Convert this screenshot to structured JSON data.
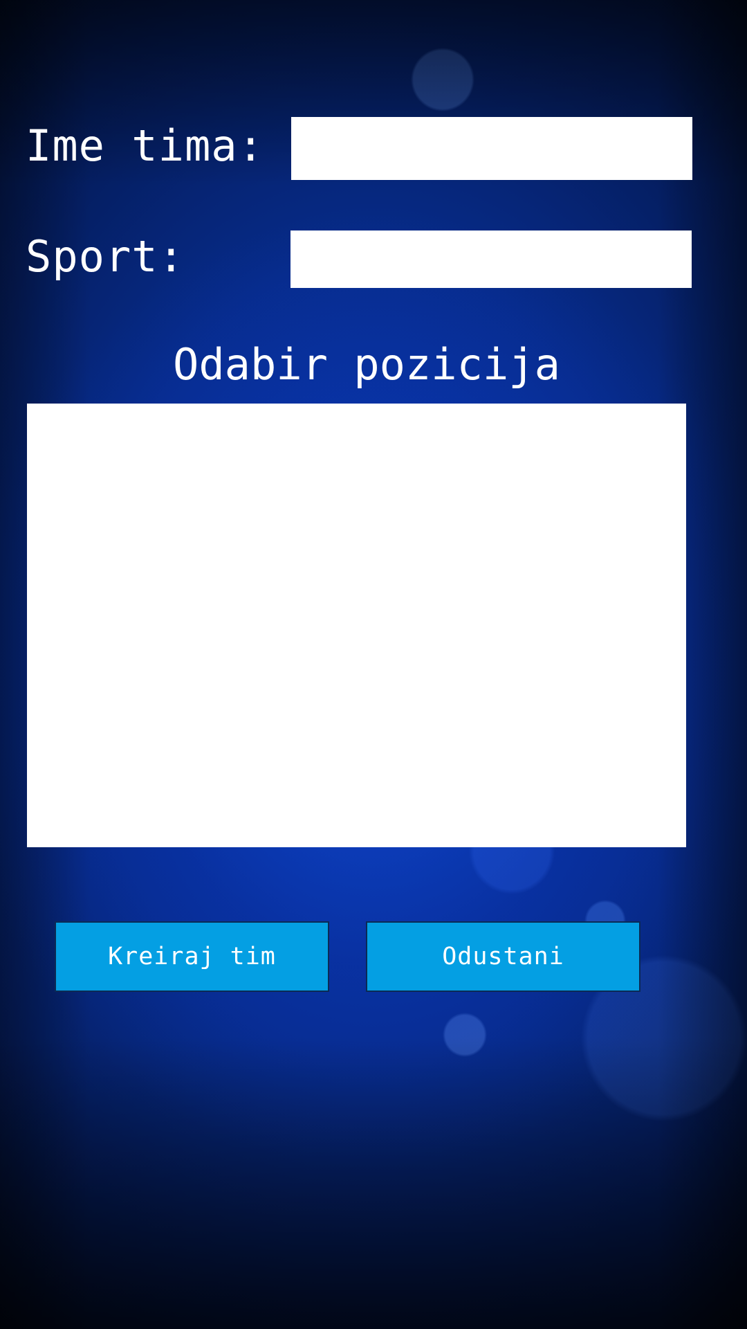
{
  "form": {
    "team_name_label": "Ime tima:",
    "team_name_value": "",
    "sport_label": "Sport:",
    "sport_value": ""
  },
  "positions": {
    "title": "Odabir pozicija",
    "items": []
  },
  "actions": {
    "create_label": "Kreiraj tim",
    "cancel_label": "Odustani"
  },
  "colors": {
    "button_background": "#049fe3",
    "background_accent": "#0a3db8",
    "field_background": "#ffffff"
  }
}
